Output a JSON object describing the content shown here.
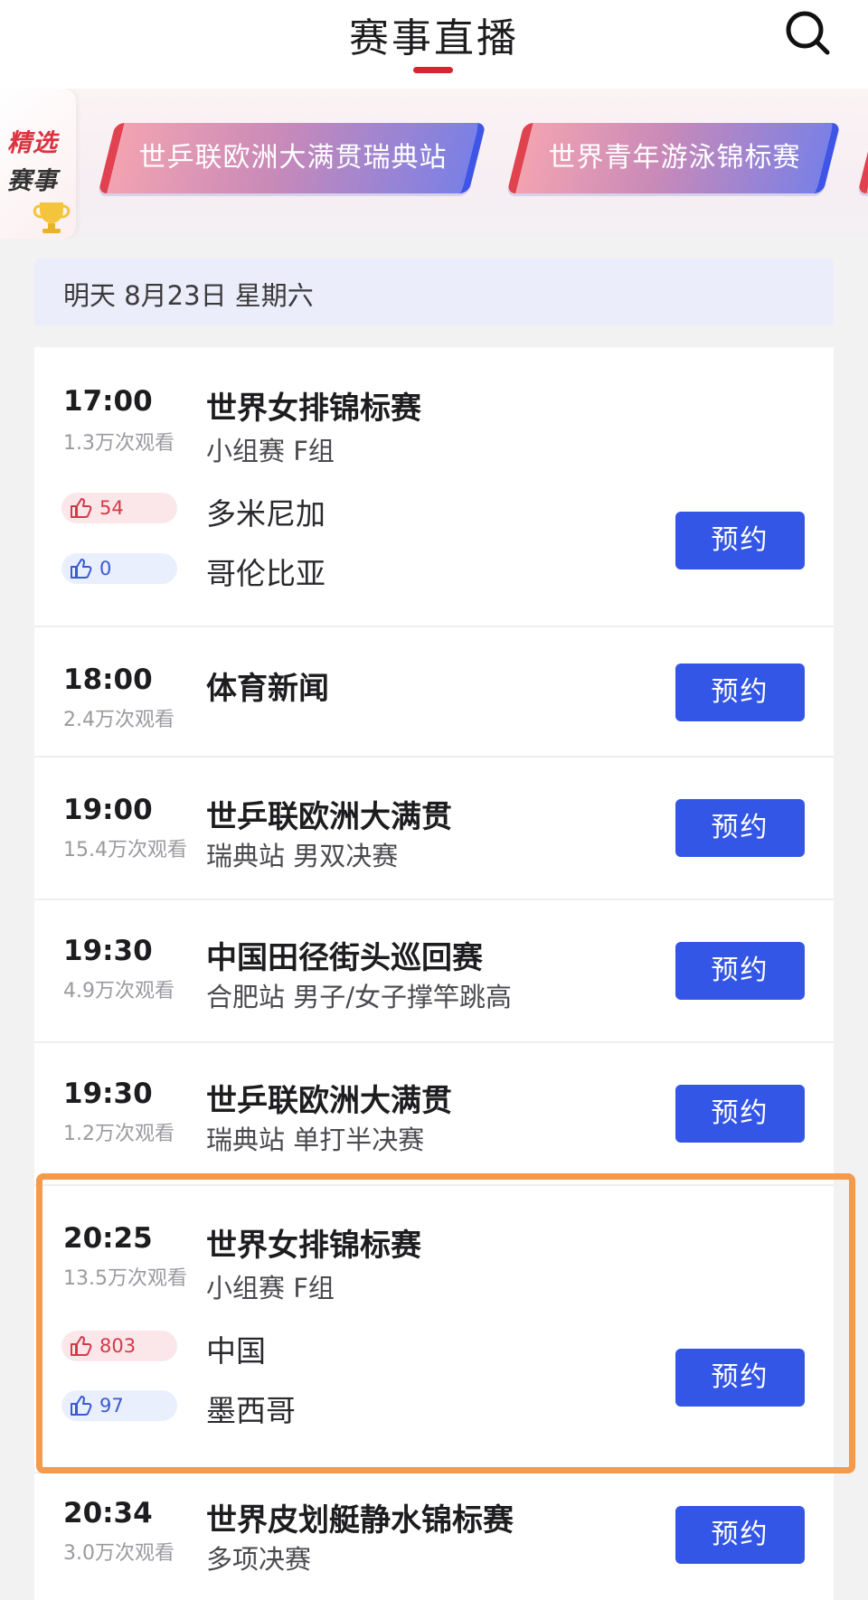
{
  "header": {
    "title": "赛事直播"
  },
  "icons": {
    "search": "search-icon",
    "trophy": "trophy-icon",
    "thumb": "thumb-up-icon"
  },
  "colors": {
    "accent_red": "#d6252e",
    "button_blue": "#3456e6",
    "highlight_orange": "#f39a4c"
  },
  "featured": {
    "label_line1": "精选",
    "label_line2": "赛事",
    "items": [
      {
        "label": "世乒联欧洲大满贯瑞典站"
      },
      {
        "label": "世界青年游泳锦标赛"
      }
    ]
  },
  "date_header": "明天 8月23日 星期六",
  "events": [
    {
      "time": "17:00",
      "views": "1.3万次观看",
      "title": "世界女排锦标赛",
      "subtitle": "小组赛 F组",
      "teams": [
        {
          "name": "多米尼加",
          "likes": "54"
        },
        {
          "name": "哥伦比亚",
          "likes": "0"
        }
      ],
      "button": "预约"
    },
    {
      "time": "18:00",
      "views": "2.4万次观看",
      "title": "体育新闻",
      "subtitle": "",
      "button": "预约"
    },
    {
      "time": "19:00",
      "views": "15.4万次观看",
      "title": "世乒联欧洲大满贯",
      "subtitle": "瑞典站 男双决赛",
      "button": "预约"
    },
    {
      "time": "19:30",
      "views": "4.9万次观看",
      "title": "中国田径街头巡回赛",
      "subtitle": "合肥站 男子/女子撑竿跳高",
      "button": "预约"
    },
    {
      "time": "19:30",
      "views": "1.2万次观看",
      "title": "世乒联欧洲大满贯",
      "subtitle": "瑞典站 单打半决赛",
      "button": "预约"
    },
    {
      "time": "20:25",
      "views": "13.5万次观看",
      "title": "世界女排锦标赛",
      "subtitle": "小组赛 F组",
      "teams": [
        {
          "name": "中国",
          "likes": "803"
        },
        {
          "name": "墨西哥",
          "likes": "97"
        }
      ],
      "button": "预约"
    },
    {
      "time": "20:34",
      "views": "3.0万次观看",
      "title": "世界皮划艇静水锦标赛",
      "subtitle": "多项决赛",
      "button": "预约"
    }
  ]
}
